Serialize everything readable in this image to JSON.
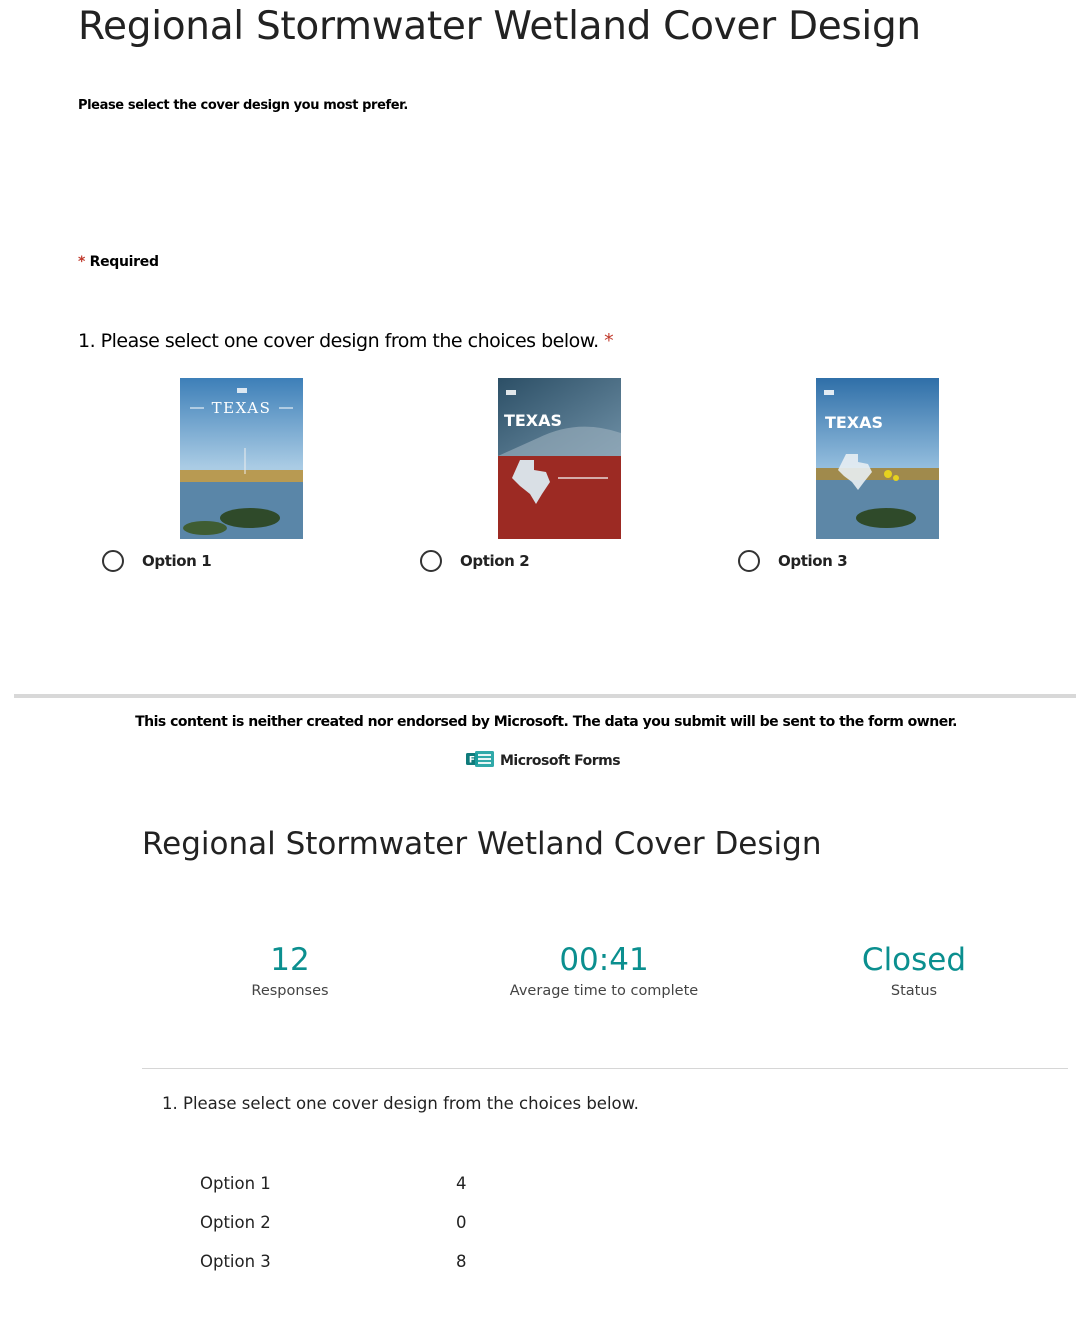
{
  "form": {
    "title": "Regional Stormwater Wetland Cover Design",
    "description": "Please select the cover design you most prefer.",
    "required_marker": "*",
    "required_label": "Required",
    "question": {
      "text": "1. Please select one cover design from the choices below.",
      "required_marker": "*",
      "options": [
        {
          "label": "Option 1",
          "cover_text": "TEXAS"
        },
        {
          "label": "Option 2",
          "cover_text": "TEXAS"
        },
        {
          "label": "Option 3",
          "cover_text": "TEXAS"
        }
      ]
    }
  },
  "footer": {
    "disclaimer": "This content is neither created nor endorsed by Microsoft. The data you submit will be sent to the form owner.",
    "brand": "Microsoft Forms",
    "brand_icon": "microsoft-forms-icon"
  },
  "results": {
    "title": "Regional Stormwater Wetland Cover Design",
    "stats": {
      "responses": {
        "value": "12",
        "label": "Responses"
      },
      "avg_time": {
        "value": "00:41",
        "label": "Average time to complete"
      },
      "status": {
        "value": "Closed",
        "label": "Status"
      }
    },
    "question": "1.  Please select one cover design from the choices below.",
    "rows": [
      {
        "option": "Option 1",
        "count": "4"
      },
      {
        "option": "Option 2",
        "count": "0"
      },
      {
        "option": "Option 3",
        "count": "8"
      }
    ]
  },
  "colors": {
    "accent": "#0b8f8f",
    "required": "#c0392b",
    "divider": "#d8d8d8"
  }
}
